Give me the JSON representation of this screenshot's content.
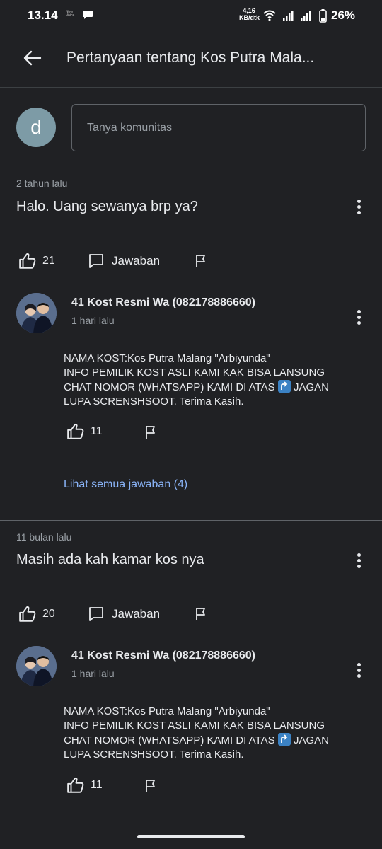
{
  "status_bar": {
    "time": "13.14",
    "tiny_icon_text": "New Voice",
    "speed_value": "4,16",
    "speed_unit": "KB/dtk",
    "battery": "26%"
  },
  "app_bar": {
    "title": "Pertanyaan tentang Kos Putra Mala..."
  },
  "ask": {
    "avatar_letter": "d",
    "placeholder": "Tanya komunitas"
  },
  "questions": [
    {
      "time": "2 tahun lalu",
      "text": "Halo. Uang sewanya brp ya?",
      "likes": "21",
      "answer_label": "Jawaban",
      "answer": {
        "name": "41 Kost Resmi Wa (082178886660)",
        "time": "1 hari lalu",
        "line1": "NAMA KOST:Kos Putra Malang \"Arbiyunda\"",
        "line2": "INFO PEMILIK KOST ASLI KAMI KAK BISA LANSUNG",
        "line3a": "CHAT NOMOR (WHATSAPP) KAMI DI ATAS",
        "line3b": "JAGAN",
        "line4": "LUPA SCRENSHSOOT. Terima Kasih.",
        "likes": "11"
      },
      "see_all": "Lihat semua jawaban (4)"
    },
    {
      "time": "11 bulan lalu",
      "text": "Masih ada kah kamar kos nya",
      "likes": "20",
      "answer_label": "Jawaban",
      "answer": {
        "name": "41 Kost Resmi Wa (082178886660)",
        "time": "1 hari lalu",
        "line1": "NAMA KOST:Kos Putra Malang \"Arbiyunda\"",
        "line2": "INFO PEMILIK KOST ASLI KAMI KAK BISA LANSUNG",
        "line3a": "CHAT NOMOR (WHATSAPP) KAMI DI ATAS",
        "line3b": "JAGAN",
        "line4": "LUPA SCRENSHSOOT. Terima Kasih.",
        "likes": "11"
      }
    }
  ],
  "colors": {
    "background": "#202124",
    "link": "#8ab4f8",
    "divider": "#5f6368"
  }
}
